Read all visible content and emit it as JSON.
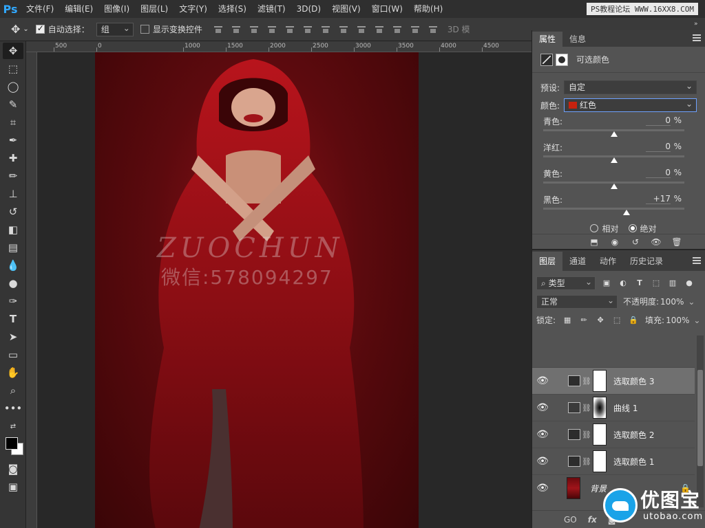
{
  "app": {
    "logo": "Ps"
  },
  "menu": [
    "文件(F)",
    "编辑(E)",
    "图像(I)",
    "图层(L)",
    "文字(Y)",
    "选择(S)",
    "滤镜(T)",
    "3D(D)",
    "视图(V)",
    "窗口(W)",
    "帮助(H)"
  ],
  "watermark_top": "PS教程论坛 WWW.16XX8.COM",
  "options": {
    "auto_select_label": "自动选择：",
    "auto_select_value": "组",
    "show_transform_label": "显示变换控件",
    "mode_3d": "3D 模"
  },
  "ruler": {
    "labels": [
      "500",
      "0",
      "1000",
      "1500",
      "2000",
      "2500",
      "3000",
      "3500",
      "4000",
      "4500"
    ]
  },
  "canvas": {
    "watermark_name": "ZUOCHUN",
    "watermark_wechat": "微信:578094297"
  },
  "properties": {
    "tabs": [
      "属性",
      "信息"
    ],
    "title": "可选颜色",
    "preset_label": "预设:",
    "preset_value": "自定",
    "color_label": "颜色:",
    "color_value": "红色",
    "color_swatch": "#c8220e",
    "sliders": [
      {
        "label": "青色:",
        "value": "0",
        "pct": "%",
        "level": 0
      },
      {
        "label": "洋红:",
        "value": "0",
        "pct": "%",
        "level": 0
      },
      {
        "label": "黄色:",
        "value": "0",
        "pct": "%",
        "level": 0
      },
      {
        "label": "黑色:",
        "value": "+17",
        "pct": "%",
        "level": 17
      }
    ],
    "method_relative": "相对",
    "method_absolute": "绝对"
  },
  "layers": {
    "tabs": [
      "图层",
      "通道",
      "动作",
      "历史记录"
    ],
    "filter_label": "类型",
    "blend_mode": "正常",
    "opacity_label": "不透明度:",
    "opacity_value": "100%",
    "lock_label": "锁定:",
    "fill_label": "填充:",
    "fill_value": "100%",
    "items": [
      {
        "name": "选取颜色 3",
        "type": "selective-color",
        "selected": true
      },
      {
        "name": "曲线 1",
        "type": "curves",
        "selected": false
      },
      {
        "name": "选取颜色 2",
        "type": "selective-color",
        "selected": false
      },
      {
        "name": "选取颜色 1",
        "type": "selective-color",
        "selected": false
      },
      {
        "name": "背景",
        "type": "background",
        "selected": false
      }
    ],
    "footer": [
      "GO",
      "fx"
    ]
  },
  "brand": {
    "cn": "优图宝",
    "en": "utobao.com"
  }
}
